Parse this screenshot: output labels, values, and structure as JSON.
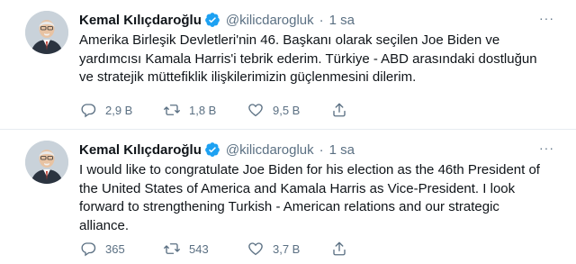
{
  "tweets": [
    {
      "author": "Kemal Kılıçdaroğlu",
      "handle": "@kilicdarogluk",
      "separator": "·",
      "time": "1 sa",
      "more": "···",
      "text": "Amerika Birleşik Devletleri'nin 46. Başkanı olarak seçilen Joe Biden ve\nyardımcısı Kamala Harris'i tebrik ederim. Türkiye - ABD arasındaki dostluğun\nve stratejik müttefiklik ilişkilerimizin güçlenmesini dilerim.",
      "replies": "2,9 B",
      "retweets": "1,8 B",
      "likes": "9,5 B",
      "icons": [
        "reply-icon",
        "retweet-icon",
        "like-icon",
        "share-icon"
      ]
    },
    {
      "author": "Kemal Kılıçdaroğlu",
      "handle": "@kilicdarogluk",
      "separator": "·",
      "time": "1 sa",
      "more": "···",
      "text": "I would like to congratulate Joe Biden for his election as the 46th President of\nthe United States of America and Kamala Harris as Vice-President. I look\nforward to strengthening Turkish - American relations and our strategic\nalliance.",
      "replies": "365",
      "retweets": "543",
      "likes": "3,7 B",
      "icons": [
        "reply-icon",
        "retweet-icon",
        "like-icon",
        "share-icon"
      ]
    }
  ],
  "colors": {
    "verified": "#1da1f2",
    "secondary_text": "#5b7083",
    "primary_text": "#0f1419",
    "divider": "#e6ecf0"
  }
}
